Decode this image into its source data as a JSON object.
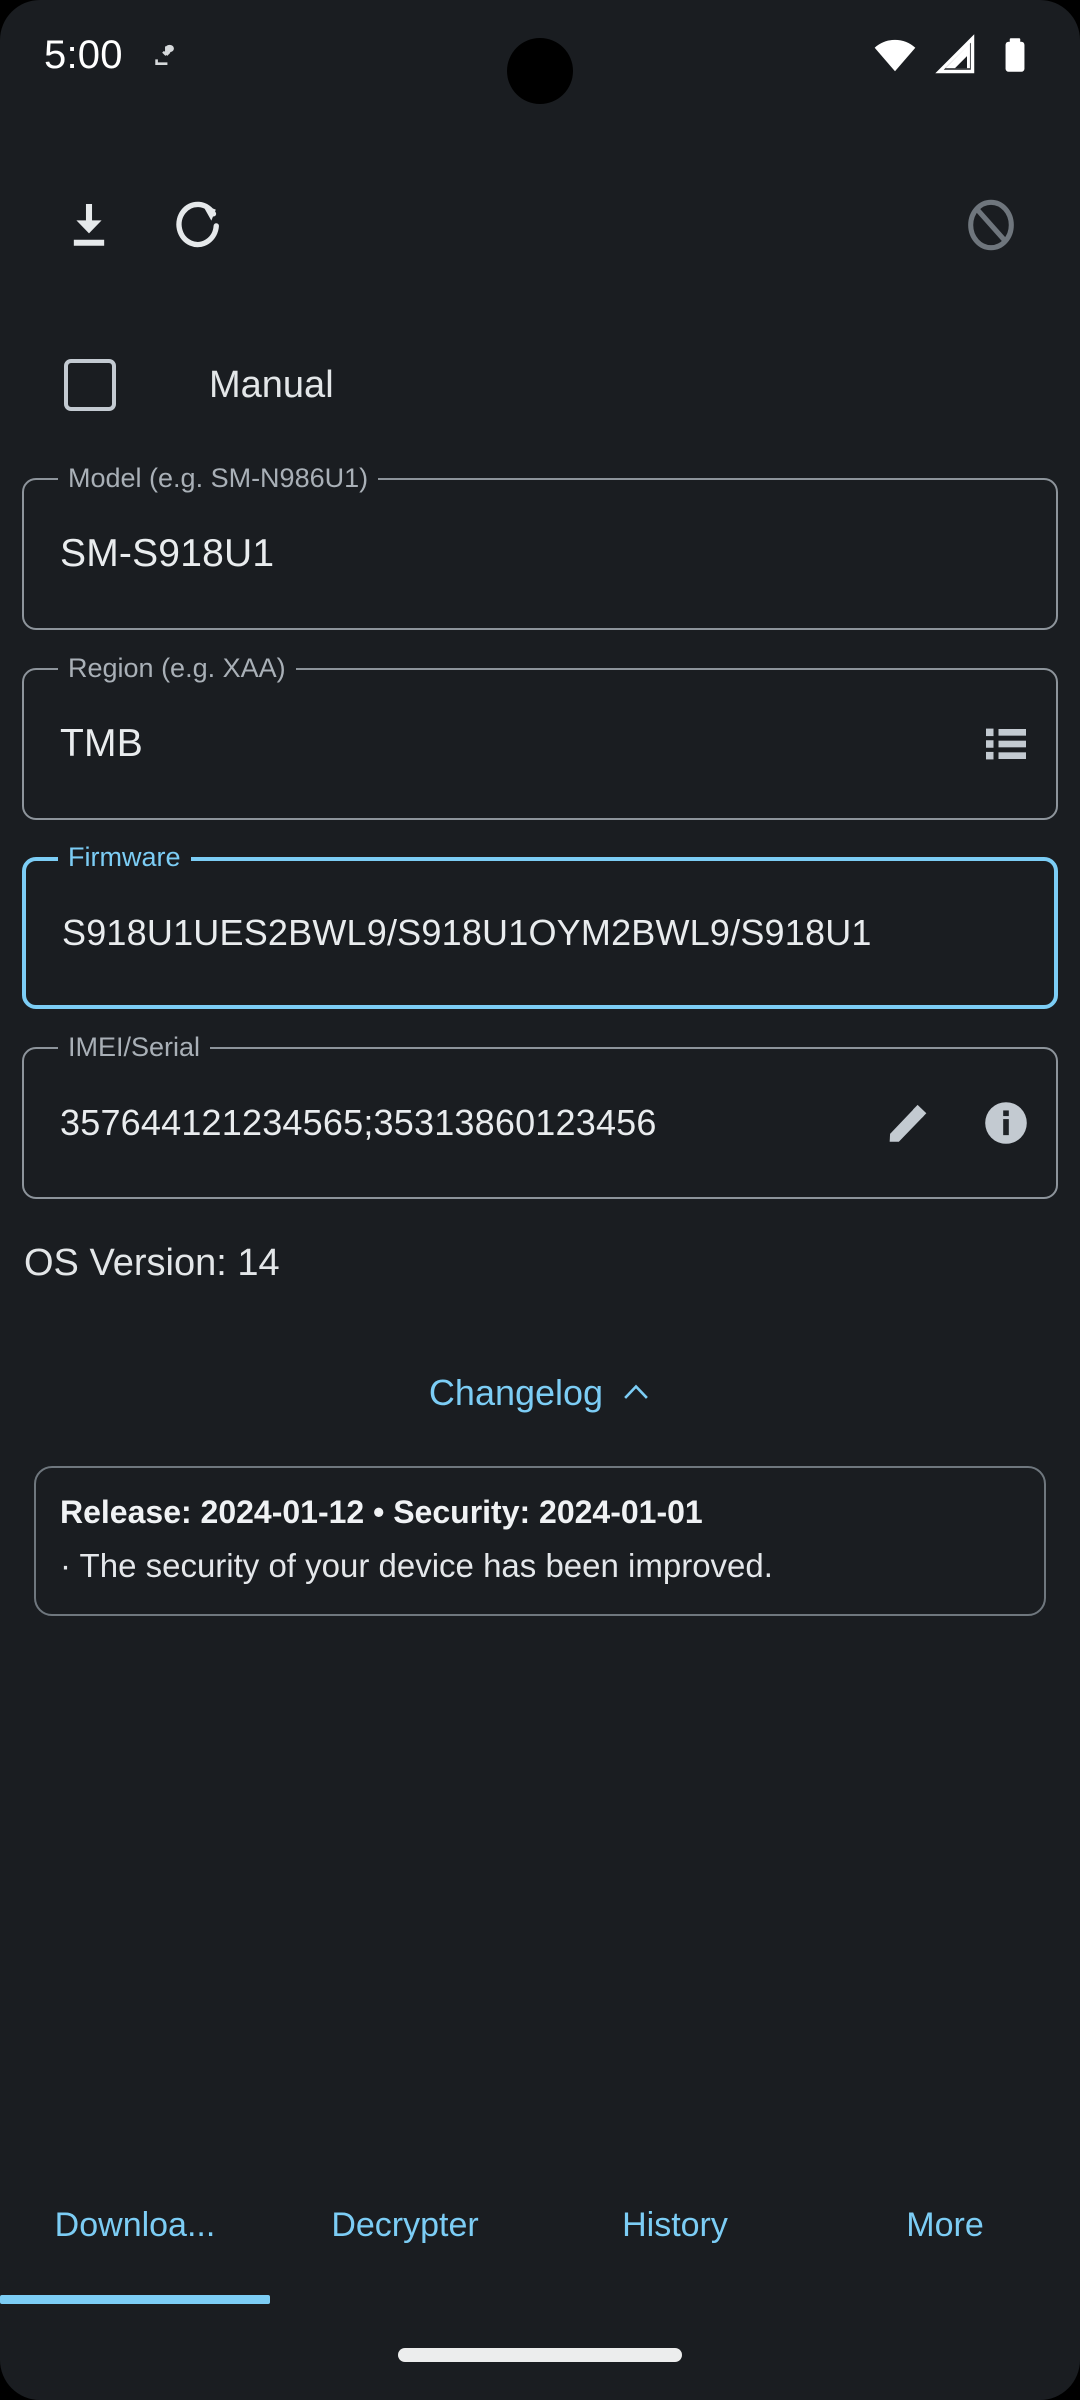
{
  "status_bar": {
    "time": "5:00",
    "notification_icon": "save-download-notification-icon",
    "wifi_icon": "wifi-full-icon",
    "signal_icon": "cellular-signal-icon",
    "battery_icon": "battery-full-icon"
  },
  "toolbar": {
    "download_icon": "download-icon",
    "refresh_icon": "refresh-icon",
    "cancel_icon": "cancel-disabled-icon"
  },
  "manual": {
    "label": "Manual",
    "checked": false
  },
  "fields": {
    "model": {
      "legend": "Model (e.g. SM-N986U1)",
      "value": "SM-S918U1",
      "placeholder": "SM-N986U1"
    },
    "region": {
      "legend": "Region (e.g. XAA)",
      "value": "TMB",
      "placeholder": "XAA",
      "trailing_icon": "list-icon"
    },
    "firmware": {
      "legend": "Firmware",
      "value": "S918U1UES2BWL9/S918U1OYM2BWL9/S918U1",
      "placeholder": "Firmware",
      "focused": true
    },
    "imei": {
      "legend": "IMEI/Serial",
      "value": "357644121234565;35313860123456",
      "placeholder": "IMEI/Serial",
      "edit_icon": "edit-pencil-icon",
      "info_icon": "info-icon"
    }
  },
  "os_version": "OS Version: 14",
  "changelog_toggle": {
    "label": "Changelog",
    "chevron_icon": "chevron-up-icon",
    "expanded": true
  },
  "changelog_card": {
    "header": "Release: 2024-01-12  •  Security: 2024-01-01",
    "body": "· The security of your device has been improved."
  },
  "tabs": [
    {
      "label": "Downloa...",
      "active": true
    },
    {
      "label": "Decrypter",
      "active": false
    },
    {
      "label": "History",
      "active": false
    },
    {
      "label": "More",
      "active": false
    }
  ],
  "colors": {
    "background": "#1a1d21",
    "accent": "#7ccdf5",
    "text_primary": "#e9ecee",
    "text_secondary": "#a9b0b7",
    "outline": "#8d949b"
  }
}
